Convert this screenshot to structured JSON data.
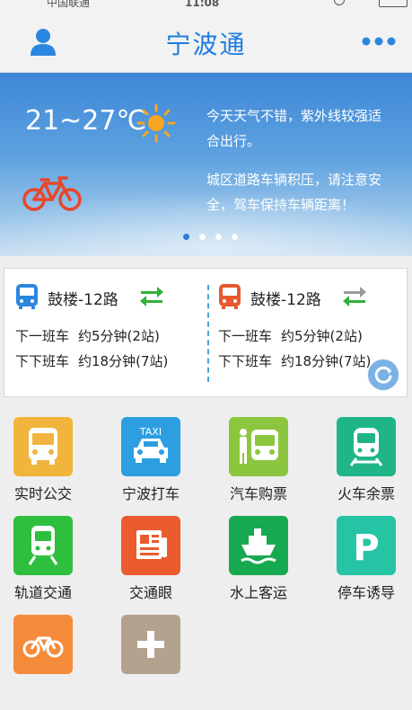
{
  "status": {
    "carrier": "中国联通",
    "time": "11:08"
  },
  "header": {
    "title": "宁波通"
  },
  "banner": {
    "temperature": "21~27℃",
    "message1": "今天天气不错，紫外线较强适合出行。",
    "message2": "城区道路车辆积压，请注意安全，驾车保持车辆距离！",
    "page_count": 4,
    "active_page": 1
  },
  "bus": {
    "left": {
      "route": "鼓楼-12路",
      "next_label": "下一班车",
      "next_value": "约5分钟(2站)",
      "after_label": "下下班车",
      "after_value": "约18分钟(7站)"
    },
    "right": {
      "route": "鼓楼-12路",
      "next_label": "下一班车",
      "next_value": "约5分钟(2站)",
      "after_label": "下下班车",
      "after_value": "约18分钟(7站)"
    }
  },
  "services": [
    {
      "label": "实时公交",
      "color": "#f1b43c",
      "icon": "bus-icon"
    },
    {
      "label": "宁波打车",
      "color": "#2d9fe0",
      "icon": "taxi-icon",
      "badge": "TAXI"
    },
    {
      "label": "汽车购票",
      "color": "#8cc63f",
      "icon": "coach-ticket-icon"
    },
    {
      "label": "火车余票",
      "color": "#1fb589",
      "icon": "train-icon"
    },
    {
      "label": "轨道交通",
      "color": "#2fbf3e",
      "icon": "metro-icon"
    },
    {
      "label": "交通眼",
      "color": "#ea5b2e",
      "icon": "newspaper-icon"
    },
    {
      "label": "水上客运",
      "color": "#17a94f",
      "icon": "ship-icon"
    },
    {
      "label": "停车诱导",
      "color": "#25c4a4",
      "icon": "parking-icon",
      "badge": "P"
    },
    {
      "label": "",
      "color": "#f58b3a",
      "icon": "bicycle-icon"
    },
    {
      "label": "",
      "color": "#b3a28d",
      "icon": "add-icon"
    }
  ]
}
